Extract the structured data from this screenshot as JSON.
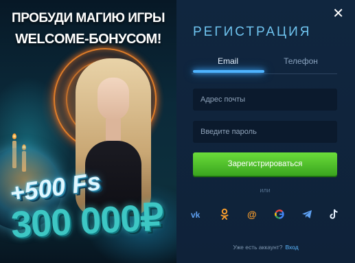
{
  "promo": {
    "headline_line1": "ПРОБУДИ МАГИЮ ИГРЫ",
    "headline_line2": "WELCOME-БОНУСОМ!",
    "bonus_freespins": "+500 Fs",
    "bonus_amount": "300 000₽"
  },
  "modal": {
    "close_label": "✕",
    "title": "РЕГИСТРАЦИЯ",
    "tabs": [
      {
        "label": "Email",
        "active": true
      },
      {
        "label": "Телефон",
        "active": false
      }
    ],
    "email_placeholder": "Адрес почты",
    "password_placeholder": "Введите пароль",
    "submit_label": "Зарегистрироваться",
    "or_label": "или",
    "socials": [
      "vk-icon",
      "odnoklassniki-icon",
      "mailru-icon",
      "google-icon",
      "telegram-icon",
      "tiktok-icon"
    ],
    "footer_text": "Уже есть аккаунт?",
    "footer_link": "Вход"
  },
  "colors": {
    "accent": "#4fb4ff",
    "submit": "#3aa51f",
    "panel": "#10263f"
  }
}
